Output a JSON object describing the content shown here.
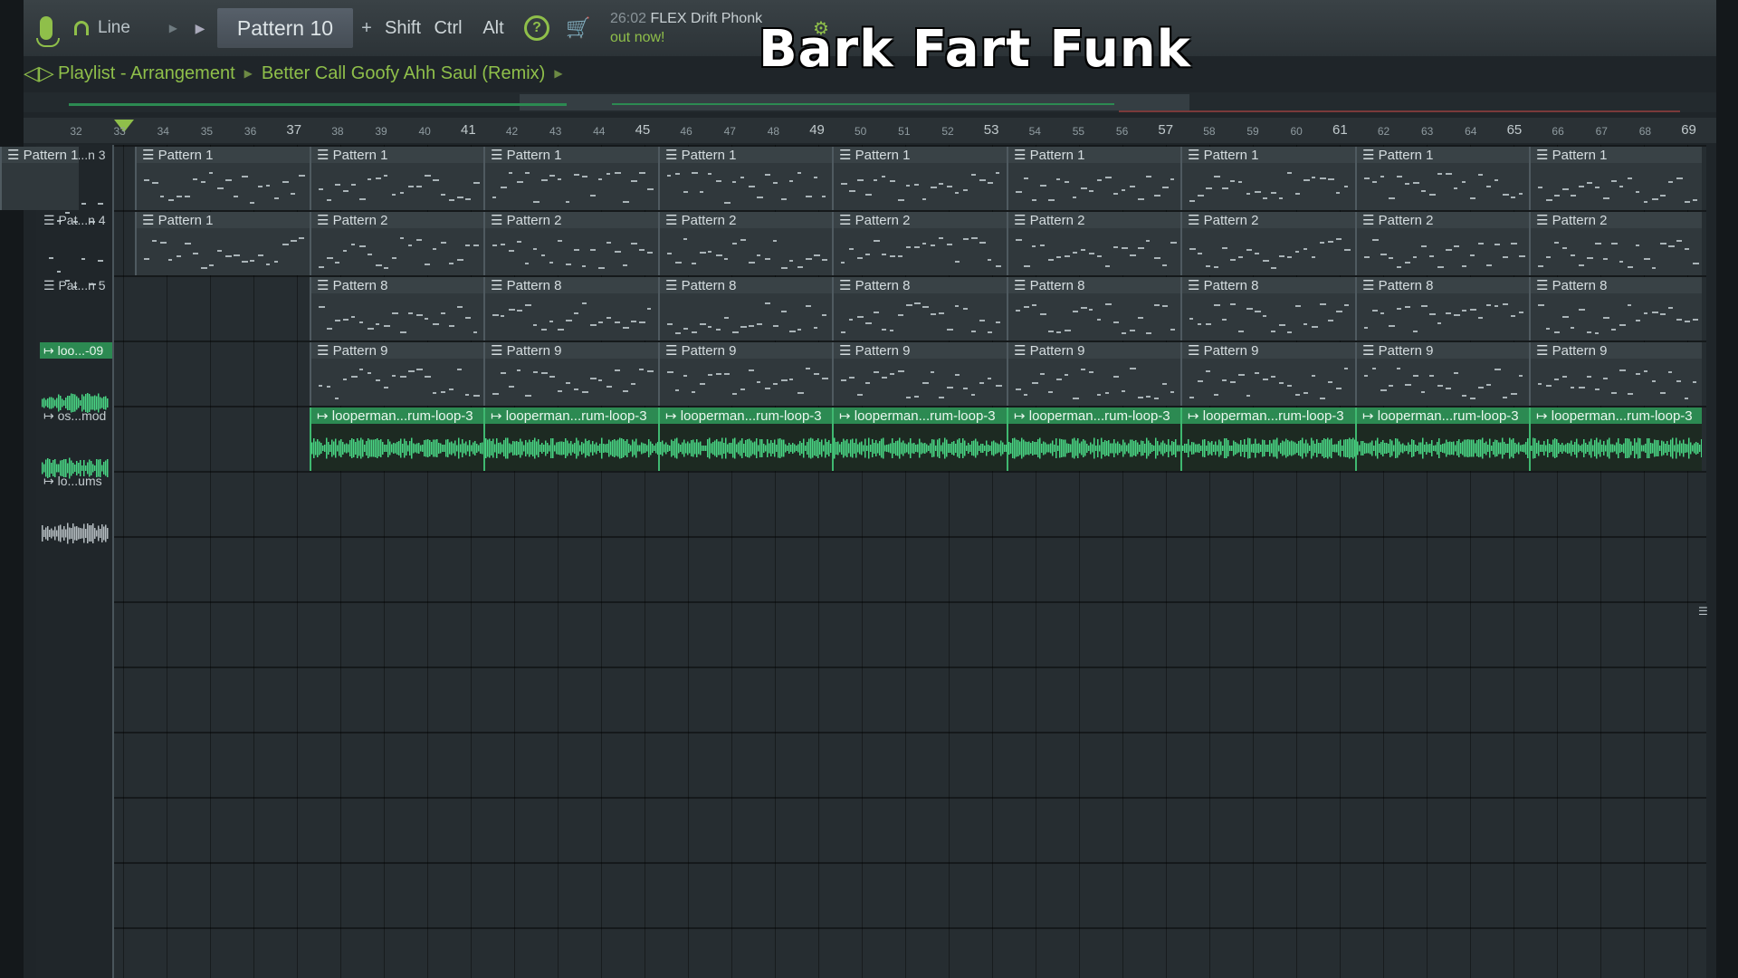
{
  "toolbar": {
    "snap_label": "Line",
    "pattern_label": "Pattern 10",
    "plus_label": "+",
    "shift_label": "Shift",
    "ctrl_label": "Ctrl",
    "alt_label": "Alt",
    "news_time": "26:02",
    "news_line1": "FLEX Drift Phonk",
    "news_line2": "out now!"
  },
  "overlay_title": "Bark Fart Funk",
  "breadcrumb": {
    "window": "Playlist - Arrangement",
    "song": "Better Call Goofy Ahh Saul (Remix)"
  },
  "ruler": {
    "bars": [
      32,
      33,
      34,
      35,
      36,
      37,
      38,
      39,
      40,
      41,
      42,
      43,
      44,
      45,
      46,
      47,
      48,
      49,
      50,
      51,
      52,
      53,
      54,
      55,
      56,
      57,
      58,
      59,
      60,
      61,
      62,
      63,
      64,
      65,
      66,
      67,
      68,
      69
    ],
    "major": [
      37,
      41,
      45,
      49,
      53,
      57,
      61,
      65,
      69
    ]
  },
  "tracks": [
    {
      "header": "Pat...n 3",
      "type": "pattern",
      "clips": [
        "Pattern 1",
        "Pattern 1",
        "Pattern 1",
        "Pattern 1",
        "Pattern 1",
        "Pattern 1",
        "Pattern 1",
        "Pattern 1",
        "Pattern 1",
        "Pattern 1"
      ],
      "starts": [
        0,
        1,
        2,
        3,
        4,
        5,
        6,
        7,
        8,
        9
      ]
    },
    {
      "header": "Pat...n 4",
      "type": "pattern",
      "clips": [
        "Pattern 1",
        "Pattern 2",
        "Pattern 2",
        "Pattern 2",
        "Pattern 2",
        "Pattern 2",
        "Pattern 2",
        "Pattern 2",
        "Pattern 2"
      ],
      "starts": [
        0,
        1,
        2,
        3,
        4,
        5,
        6,
        7,
        8
      ]
    },
    {
      "header": "Pat...n 5",
      "type": "pattern",
      "clips": [
        "Pattern 8",
        "Pattern 8",
        "Pattern 8",
        "Pattern 8",
        "Pattern 8",
        "Pattern 8",
        "Pattern 8",
        "Pattern 8"
      ],
      "starts": [
        1,
        2,
        3,
        4,
        5,
        6,
        7,
        8
      ]
    },
    {
      "header": "loo...-09",
      "type": "audio-header",
      "clips": [
        "Pattern 9",
        "Pattern 9",
        "Pattern 9",
        "Pattern 9",
        "Pattern 9",
        "Pattern 9",
        "Pattern 9",
        "Pattern 9"
      ],
      "starts": [
        1,
        2,
        3,
        4,
        5,
        6,
        7,
        8
      ]
    },
    {
      "header": "os...mod",
      "type": "audio",
      "clips": [
        "looperman...rum-loop-3",
        "looperman...rum-loop-3",
        "looperman...rum-loop-3",
        "looperman...rum-loop-3",
        "looperman...rum-loop-3",
        "looperman...rum-loop-3",
        "looperman...rum-loop-3",
        "looperman...rum-loop-3"
      ],
      "starts": [
        1,
        2,
        3,
        4,
        5,
        6,
        7,
        8
      ]
    },
    {
      "header": "lo...ums",
      "type": "audio-empty",
      "clips": [],
      "starts": []
    }
  ],
  "colors": {
    "accent": "#8fbf4a",
    "audio_green": "#2c8a52",
    "wave_green": "#49d684"
  },
  "icons": {
    "mic": "microphone-icon",
    "snap": "magnet-icon",
    "help": "help-icon",
    "cart": "cart-icon",
    "speaker": "speaker-icon"
  }
}
